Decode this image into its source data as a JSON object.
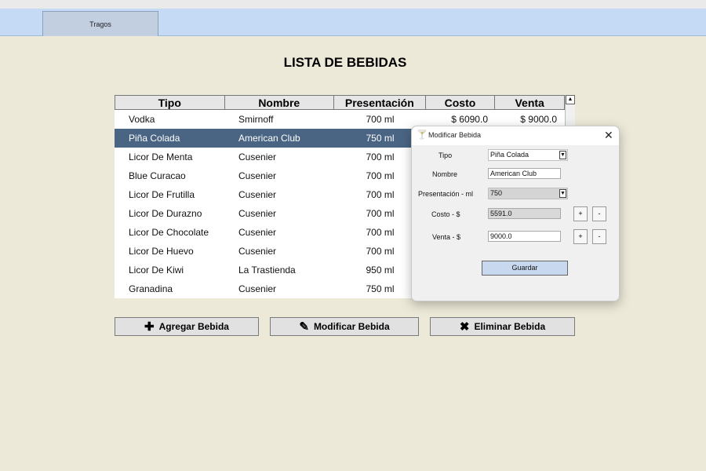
{
  "tabs": [
    "Tragos"
  ],
  "page_title": "LISTA DE BEBIDAS",
  "table": {
    "headers": [
      "Tipo",
      "Nombre",
      "Presentación",
      "Costo",
      "Venta"
    ],
    "rows": [
      [
        "Vodka",
        "Smirnoff",
        "700 ml",
        "$ 6090.0",
        "$ 9000.0"
      ],
      [
        "Piña Colada",
        "American Club",
        "750 ml",
        "",
        ""
      ],
      [
        "Licor De Menta",
        "Cusenier",
        "700 ml",
        "",
        ""
      ],
      [
        "Blue Curacao",
        "Cusenier",
        "700 ml",
        "",
        ""
      ],
      [
        "Licor De Frutilla",
        "Cusenier",
        "700 ml",
        "",
        ""
      ],
      [
        "Licor De Durazno",
        "Cusenier",
        "700 ml",
        "",
        ""
      ],
      [
        "Licor De Chocolate",
        "Cusenier",
        "700 ml",
        "",
        ""
      ],
      [
        "Licor De Huevo",
        "Cusenier",
        "700 ml",
        "",
        ""
      ],
      [
        "Licor De Kiwi",
        "La Trastienda",
        "950 ml",
        "",
        ""
      ],
      [
        "Granadina",
        "Cusenier",
        "750 ml",
        "",
        ""
      ]
    ],
    "selected_row": 1,
    "scroll_up_glyph": "▲"
  },
  "buttons": {
    "add": {
      "label": "Agregar Bebida",
      "icon": "plus-icon",
      "glyph": "✚"
    },
    "edit": {
      "label": "Modificar Bebida",
      "icon": "pencil-icon",
      "glyph": "✎"
    },
    "delete": {
      "label": "Eliminar Bebida",
      "icon": "x-icon",
      "glyph": "✖"
    }
  },
  "dialog": {
    "title": "Modificar Bebida",
    "app_icon": "cocktail-icon",
    "app_glyph": "🍸",
    "close_glyph": "✕",
    "dropdown_glyph": "▼",
    "fields": {
      "tipo": {
        "label": "Tipo",
        "value": "Piña Colada"
      },
      "nombre": {
        "label": "Nombre",
        "value": "American Club"
      },
      "presentacion": {
        "label": "Presentación - ml",
        "value": "750"
      },
      "costo": {
        "label": "Costo - $",
        "value": "5591.0"
      },
      "venta": {
        "label": "Venta - $",
        "value": "9000.0"
      }
    },
    "plus": "+",
    "minus": "-",
    "save_label": "Guardar"
  },
  "colors": {
    "background": "#ece9d8",
    "tabbar": "#c5dbf5",
    "selection": "#4a6584",
    "save_button": "#c8d8ee"
  }
}
